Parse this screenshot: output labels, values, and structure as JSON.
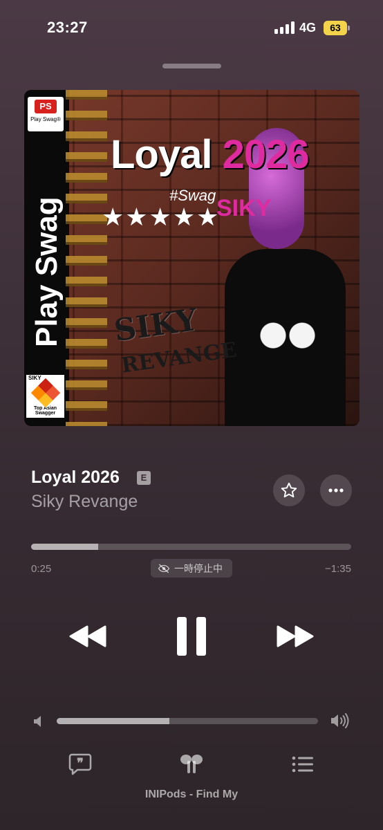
{
  "status_bar": {
    "time": "23:27",
    "network": "4G",
    "battery": "63"
  },
  "artwork": {
    "ps_logo_text": "PS",
    "ps_logo_sub": "Play Swag®",
    "vertical_title": "Play Swag",
    "title_main": "Loyal ",
    "title_accent": "2026",
    "hashtag": "#Swag",
    "stars": "★★★★★",
    "brand_pink": "SIKY",
    "graffiti_top": "SIKY",
    "graffiti_bottom": "REVANGE",
    "siky_logo_top": "SIKY",
    "siky_logo_sub": "Top Asian Swagger"
  },
  "track": {
    "title": "Loyal 2026",
    "explicit": "E",
    "artist": "Siky Revange"
  },
  "playback": {
    "elapsed": "0:25",
    "remaining": "−1:35",
    "progress": 0.21,
    "paused_label": "一時停止中"
  },
  "volume": {
    "level": 0.43
  },
  "output_device": "INIPods - Find My",
  "colors": {
    "background": "#3f3139",
    "explicit_badge": "#8f8589",
    "accent_pink": "#e02aa0"
  },
  "icons": [
    "star-icon",
    "more-icon",
    "rewind-icon",
    "pause-icon",
    "forward-icon",
    "volume-low-icon",
    "volume-high-icon",
    "lyrics-icon",
    "airpods-icon",
    "queue-icon",
    "eye-slash-icon"
  ]
}
